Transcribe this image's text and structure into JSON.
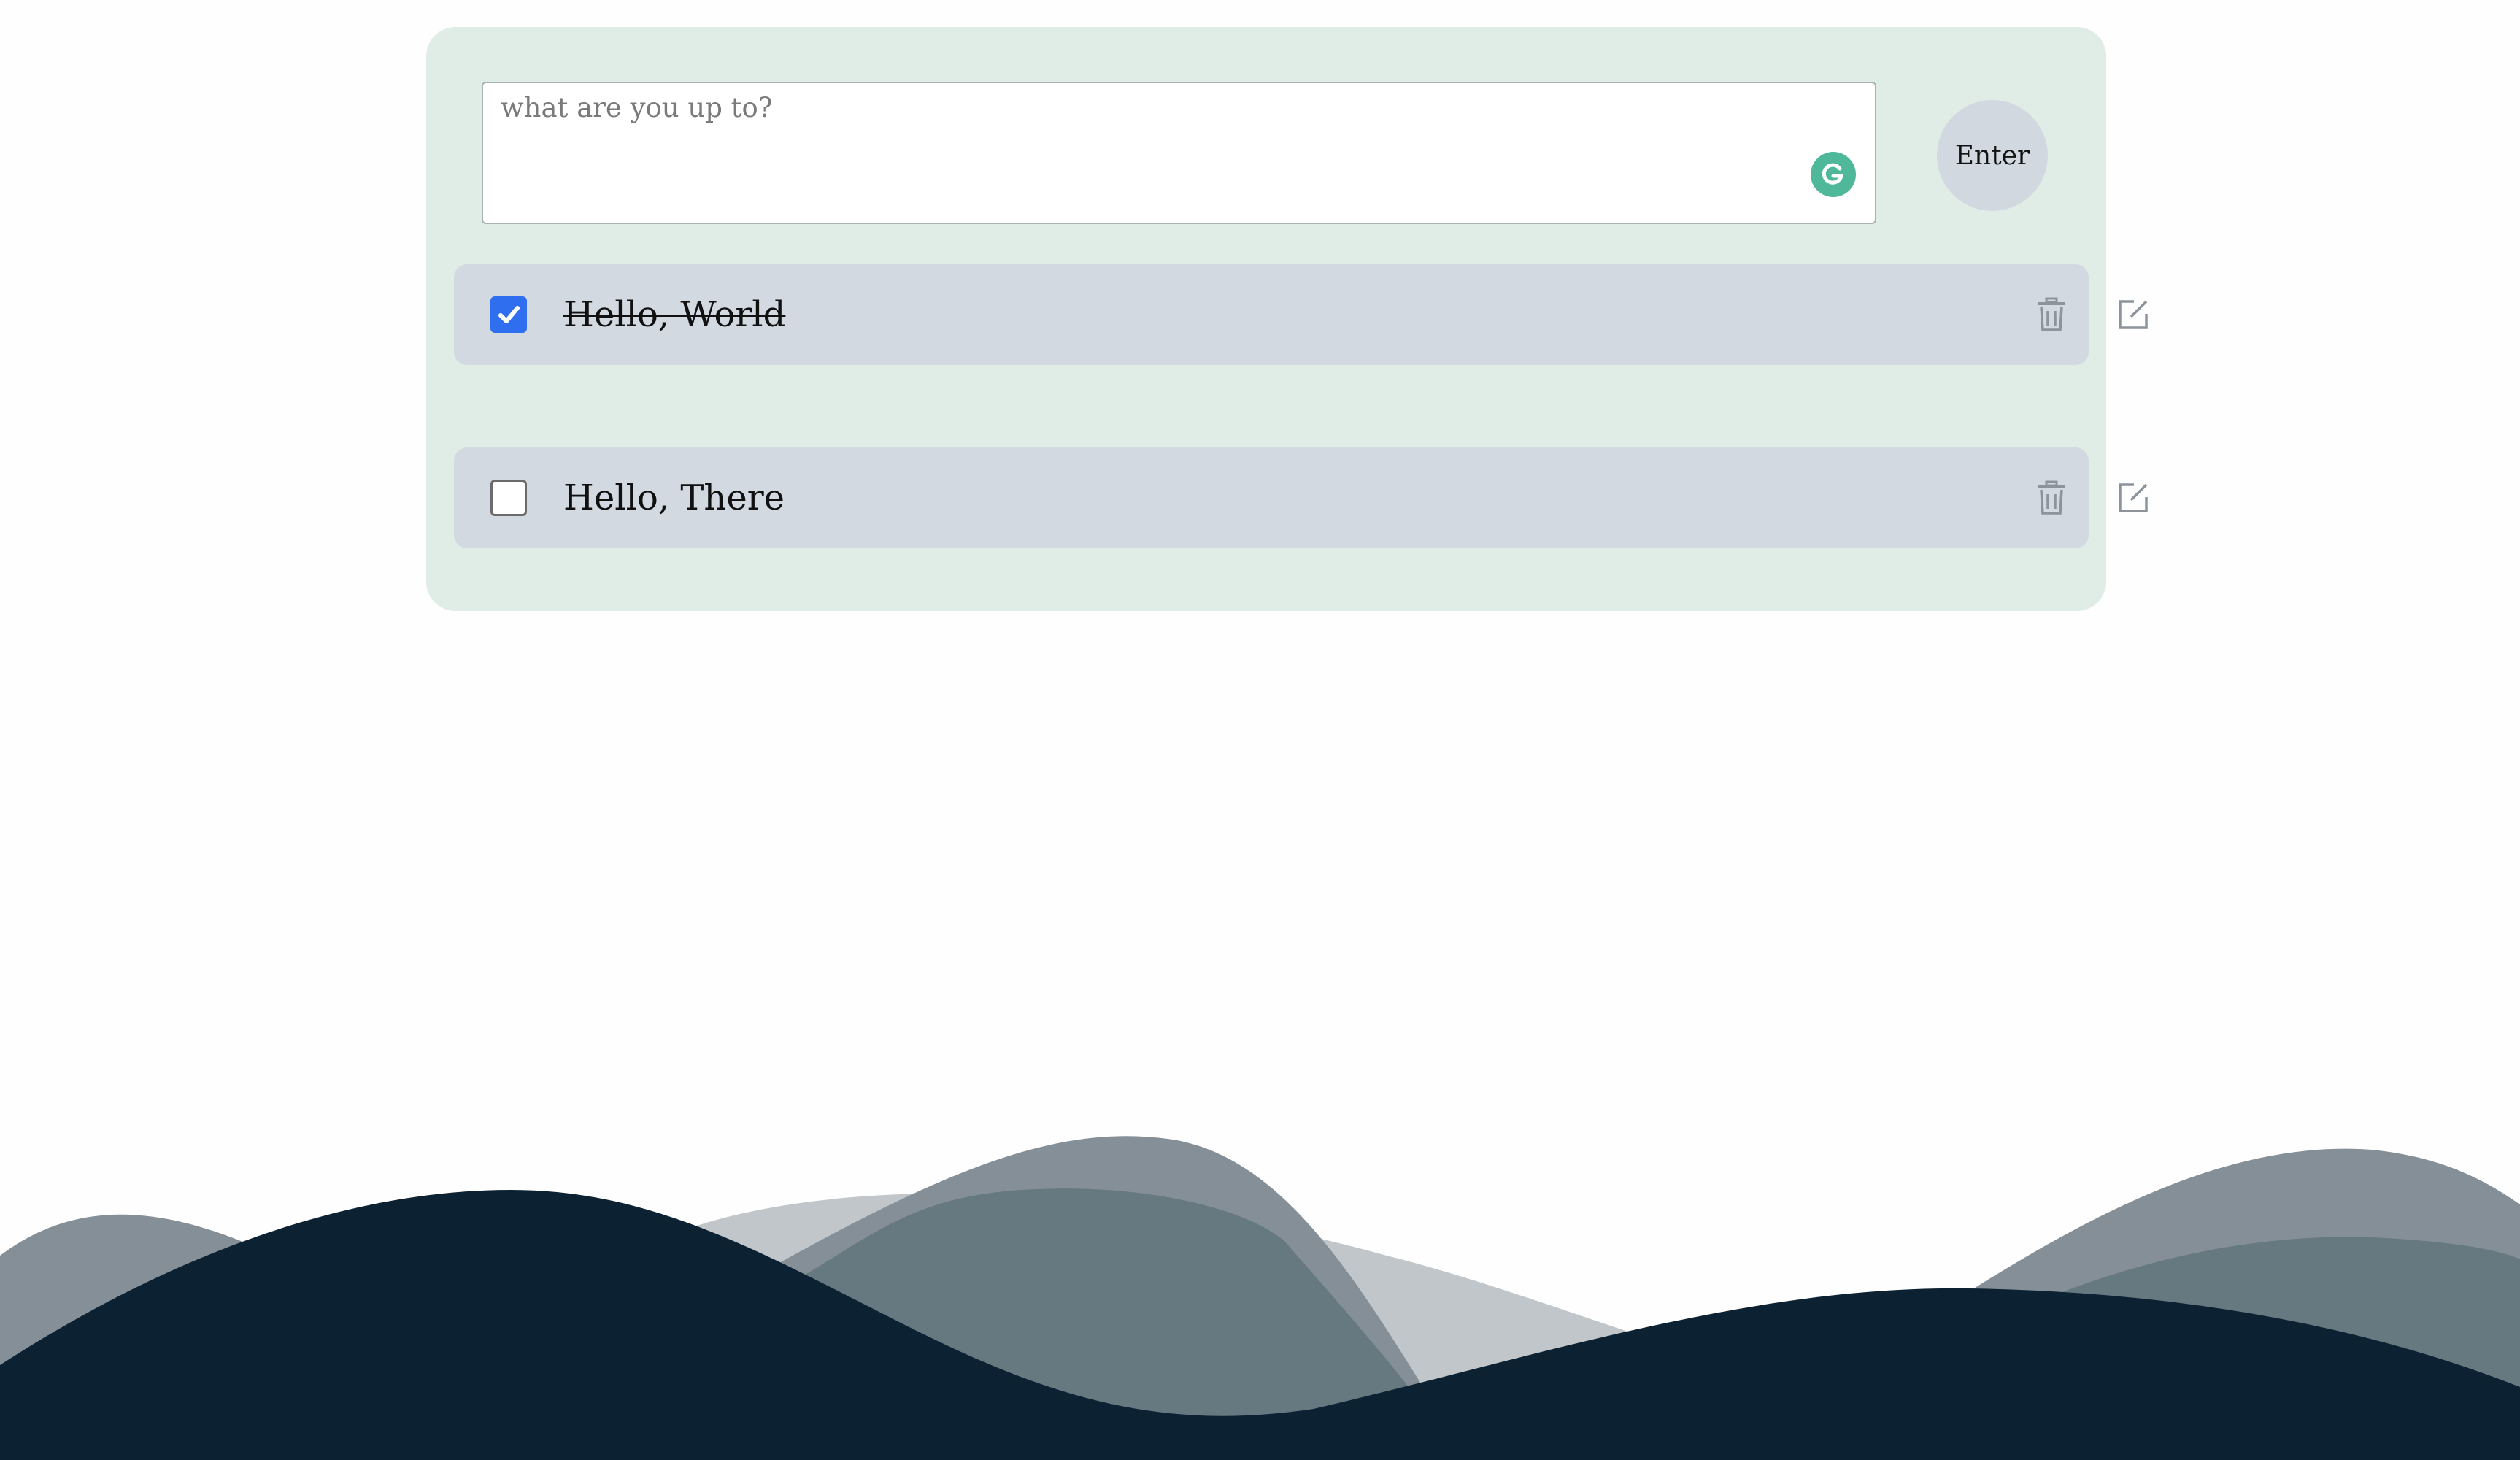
{
  "entry": {
    "placeholder": "what are you up to?",
    "value": "",
    "submit_label": "Enter"
  },
  "todos": [
    {
      "text": "Hello, World",
      "completed": true
    },
    {
      "text": "Hello, There",
      "completed": false
    }
  ],
  "icons": {
    "grammarly": "grammarly-g-icon",
    "check": "checkmark-icon",
    "delete": "trash-icon",
    "edit": "edit-square-pencil-icon"
  },
  "colors": {
    "card_background": "#e0ede6",
    "todo_row_background": "#d2d9e1",
    "checkbox_checked": "#2f6fef",
    "wave_dark": "#0c2233",
    "grammarly_green": "#4fb89a"
  }
}
